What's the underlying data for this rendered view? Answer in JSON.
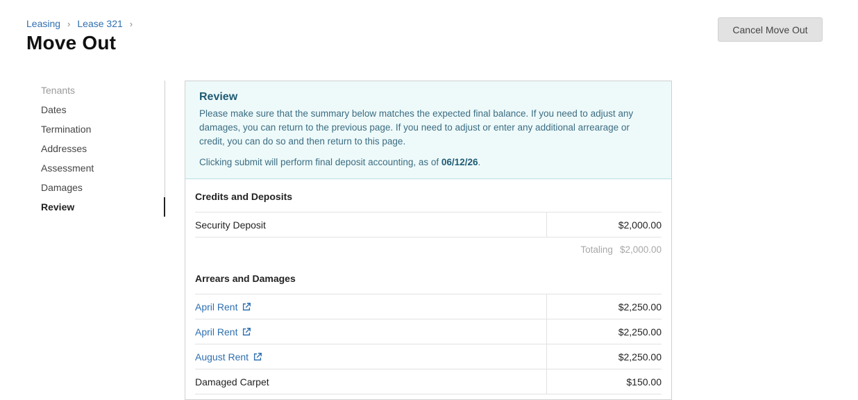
{
  "breadcrumb": {
    "items": [
      "Leasing",
      "Lease 321"
    ]
  },
  "page": {
    "title": "Move Out"
  },
  "actions": {
    "cancel_label": "Cancel Move Out"
  },
  "sidebar": {
    "items": [
      {
        "label": "Tenants",
        "state": "disabled"
      },
      {
        "label": "Dates",
        "state": "normal"
      },
      {
        "label": "Termination",
        "state": "normal"
      },
      {
        "label": "Addresses",
        "state": "normal"
      },
      {
        "label": "Assessment",
        "state": "normal"
      },
      {
        "label": "Damages",
        "state": "normal"
      },
      {
        "label": "Review",
        "state": "active"
      }
    ]
  },
  "review": {
    "title": "Review",
    "body": "Please make sure that the summary below matches the expected final balance. If you need to adjust any damages, you can return to the previous page. If you need to adjust or enter any additional arrearage or credit, you can do so and then return to this page.",
    "submit_prefix": "Clicking submit will perform final deposit accounting, as of ",
    "submit_date": "06/12/26",
    "submit_suffix": "."
  },
  "credits": {
    "title": "Credits and Deposits",
    "rows": [
      {
        "label": "Security Deposit",
        "amount": "$2,000.00"
      }
    ],
    "total_label": "Totaling",
    "total_value": "$2,000.00"
  },
  "arrears": {
    "title": "Arrears and Damages",
    "rows": [
      {
        "label": "April Rent",
        "amount": "$2,250.00"
      },
      {
        "label": "April Rent",
        "amount": "$2,250.00"
      },
      {
        "label": "August Rent",
        "amount": "$2,250.00"
      },
      {
        "label": "Damaged Carpet",
        "amount": "$150.00"
      }
    ]
  },
  "colors": {
    "link": "#2f6fb0",
    "review_bg": "#eefafa",
    "review_text": "#3b6c82"
  }
}
